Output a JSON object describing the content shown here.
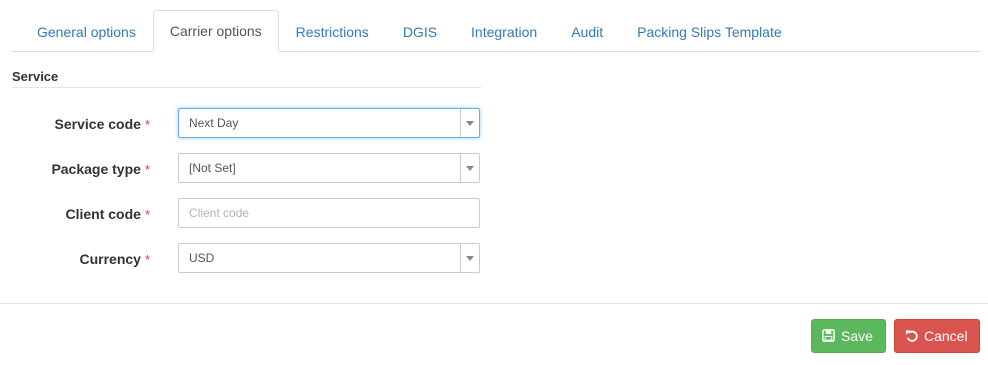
{
  "tabs": [
    {
      "label": "General options",
      "active": false
    },
    {
      "label": "Carrier options",
      "active": true
    },
    {
      "label": "Restrictions",
      "active": false
    },
    {
      "label": "DGIS",
      "active": false
    },
    {
      "label": "Integration",
      "active": false
    },
    {
      "label": "Audit",
      "active": false
    },
    {
      "label": "Packing Slips Template",
      "active": false
    }
  ],
  "section": {
    "title": "Service"
  },
  "form": {
    "service_code": {
      "label": "Service code",
      "required": "*",
      "value": "Next Day"
    },
    "package_type": {
      "label": "Package type",
      "required": "*",
      "value": "[Not Set]"
    },
    "client_code": {
      "label": "Client code",
      "required": "*",
      "value": "",
      "placeholder": "Client code"
    },
    "currency": {
      "label": "Currency",
      "required": "*",
      "value": "USD"
    }
  },
  "footer": {
    "save_label": "Save",
    "cancel_label": "Cancel"
  },
  "colors": {
    "link": "#337ab7",
    "save": "#5cb85c",
    "cancel": "#d9534f",
    "required": "#e23b3b"
  },
  "icons": {
    "save": "floppy-disk-icon",
    "cancel": "undo-icon",
    "dropdown": "caret-down-icon"
  }
}
